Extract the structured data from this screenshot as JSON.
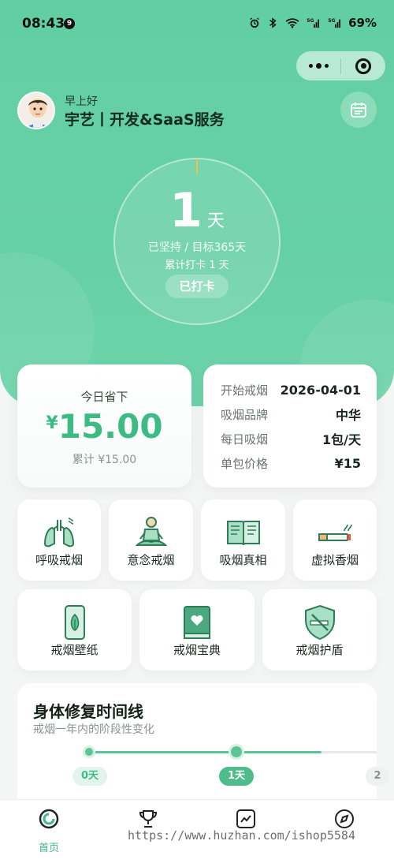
{
  "status_bar": {
    "time": "08:43",
    "notification_count": "9",
    "battery": "69%"
  },
  "header": {
    "greeting": "早上好",
    "username": "宇艺丨开发&SaaS服务"
  },
  "progress": {
    "days": "1",
    "days_unit": "天",
    "persist_text": "已坚持 / 目标365天",
    "total_check": "累计打卡 1 天",
    "checked_label": "已打卡"
  },
  "savings": {
    "title": "今日省下",
    "currency": "¥",
    "amount": "15.00",
    "total": "累计 ¥15.00"
  },
  "info": [
    {
      "key": "开始戒烟",
      "value": "2026-04-01"
    },
    {
      "key": "吸烟品牌",
      "value": "中华"
    },
    {
      "key": "每日吸烟",
      "value": "1包/天"
    },
    {
      "key": "单包价格",
      "value": "¥15"
    }
  ],
  "tools_row1": [
    {
      "label": "呼吸戒烟",
      "icon": "lungs-icon"
    },
    {
      "label": "意念戒烟",
      "icon": "meditation-icon"
    },
    {
      "label": "吸烟真相",
      "icon": "open-book-icon"
    },
    {
      "label": "虚拟香烟",
      "icon": "cigarette-icon"
    }
  ],
  "tools_row2": [
    {
      "label": "戒烟壁纸",
      "icon": "phone-leaf-icon"
    },
    {
      "label": "戒烟宝典",
      "icon": "heart-book-icon"
    },
    {
      "label": "戒烟护盾",
      "icon": "shield-no-smoking-icon"
    }
  ],
  "timeline": {
    "title": "身体修复时间线",
    "subtitle": "戒烟一年内的阶段性变化",
    "nodes": [
      "0天",
      "1天",
      "2"
    ]
  },
  "tabbar": {
    "items": [
      {
        "label": "首页",
        "icon": "home-ring-icon",
        "active": true
      },
      {
        "label": "",
        "icon": "trophy-icon",
        "active": false
      },
      {
        "label": "",
        "icon": "chart-icon",
        "active": false
      },
      {
        "label": "",
        "icon": "compass-icon",
        "active": false
      }
    ]
  },
  "watermark": "https://www.huzhan.com/ishop5584",
  "colors": {
    "brand_green": "#62cfa2",
    "accent_green": "#3dbb84",
    "icon_green": "#3f9a6e"
  }
}
